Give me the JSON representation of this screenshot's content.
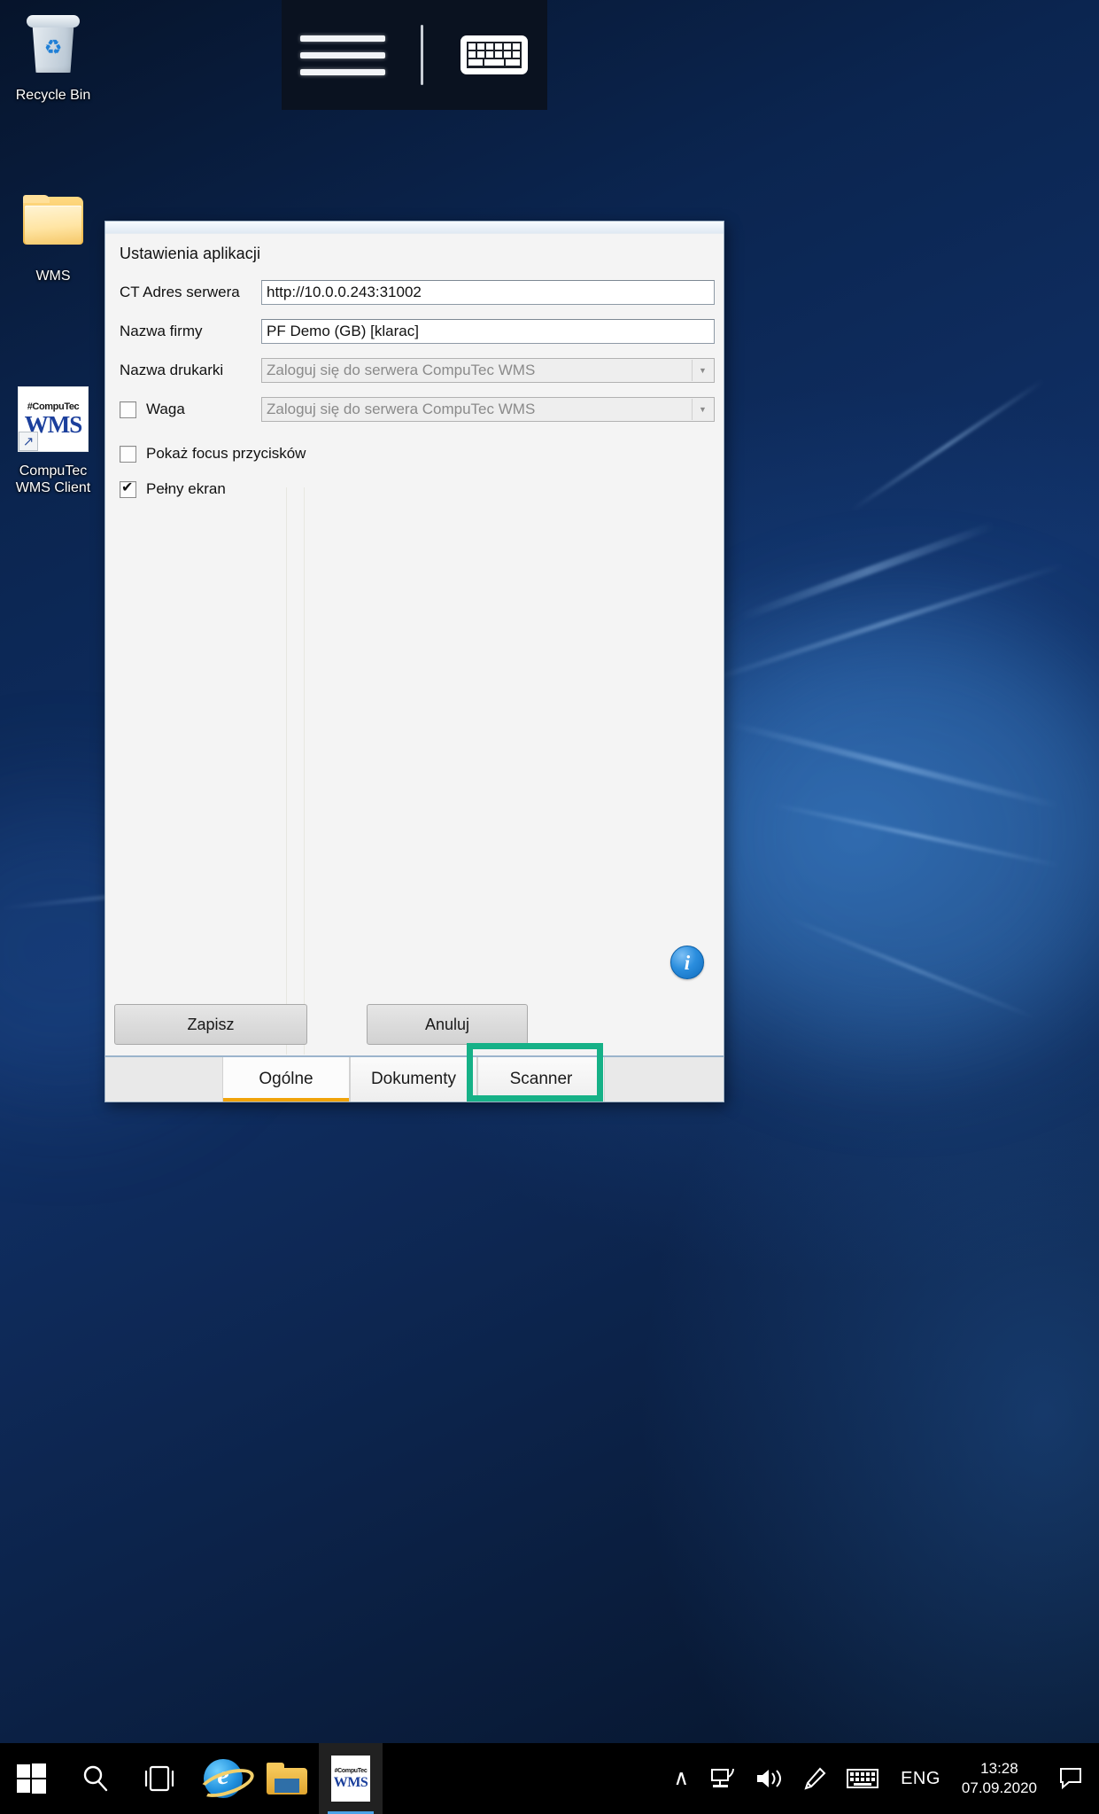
{
  "desktop": {
    "icons": [
      {
        "name": "recycle-bin",
        "label": "Recycle Bin"
      },
      {
        "name": "wms-folder",
        "label": "WMS"
      },
      {
        "name": "computec-wms-client",
        "label": "CompuTec\nWMS Client",
        "label_line1": "CompuTec",
        "label_line2": "WMS Client",
        "tile_top": "#CompuTec",
        "tile_main": "WMS"
      }
    ]
  },
  "top_bar": {
    "menu_icon": "hamburger-menu-icon",
    "keyboard_icon": "on-screen-keyboard-icon"
  },
  "dialog": {
    "caption": "Ustawienia aplikacji",
    "fields": [
      {
        "label": "CT Adres serwera",
        "value": "http://10.0.0.243:31002",
        "type": "text",
        "enabled": true
      },
      {
        "label": "Nazwa firmy",
        "value": "PF Demo (GB) [klarac]",
        "type": "text",
        "enabled": true
      },
      {
        "label": "Nazwa drukarki",
        "value": "Zaloguj się do serwera CompuTec WMS",
        "type": "combo",
        "enabled": false
      }
    ],
    "weight_row": {
      "checkbox_label": "Waga",
      "checked": false,
      "combo_value": "Zaloguj się do serwera CompuTec WMS",
      "enabled": false
    },
    "checkboxes": [
      {
        "label": "Pokaż focus przycisków",
        "checked": false
      },
      {
        "label": "Pełny ekran",
        "checked": true
      }
    ],
    "info_icon": "information-icon",
    "info_glyph": "i",
    "buttons": {
      "save": "Zapisz",
      "cancel": "Anuluj"
    },
    "tabs": [
      {
        "label": "Ogólne",
        "active": true,
        "highlighted": false
      },
      {
        "label": "Dokumenty",
        "active": false,
        "highlighted": false
      },
      {
        "label": "Scanner",
        "active": false,
        "highlighted": true
      }
    ],
    "highlight_color": "#16b187",
    "active_tab_underline_color": "#f0a30a"
  },
  "taskbar": {
    "items": [
      {
        "name": "start-button",
        "icon": "windows-logo-icon"
      },
      {
        "name": "search-button",
        "icon": "search-icon"
      },
      {
        "name": "task-view-button",
        "icon": "task-view-icon"
      },
      {
        "name": "internet-explorer-button",
        "icon": "internet-explorer-icon",
        "letter": "e"
      },
      {
        "name": "file-explorer-button",
        "icon": "file-explorer-icon"
      },
      {
        "name": "computec-wms-taskbar-button",
        "icon": "computec-wms-icon",
        "tile_top": "#CompuTec",
        "tile_main": "WMS",
        "active": true
      }
    ],
    "tray": [
      {
        "name": "show-hidden-icons",
        "icon": "chevron-up-icon",
        "glyph": "∧"
      },
      {
        "name": "network-icon",
        "icon": "network-icon"
      },
      {
        "name": "volume-icon",
        "icon": "speaker-icon"
      },
      {
        "name": "pen-icon",
        "icon": "pen-icon"
      },
      {
        "name": "touch-keyboard-icon",
        "icon": "keyboard-icon"
      }
    ],
    "language": "ENG",
    "clock": {
      "time": "13:28",
      "date": "07.09.2020"
    },
    "action_center": "action-center-icon"
  }
}
